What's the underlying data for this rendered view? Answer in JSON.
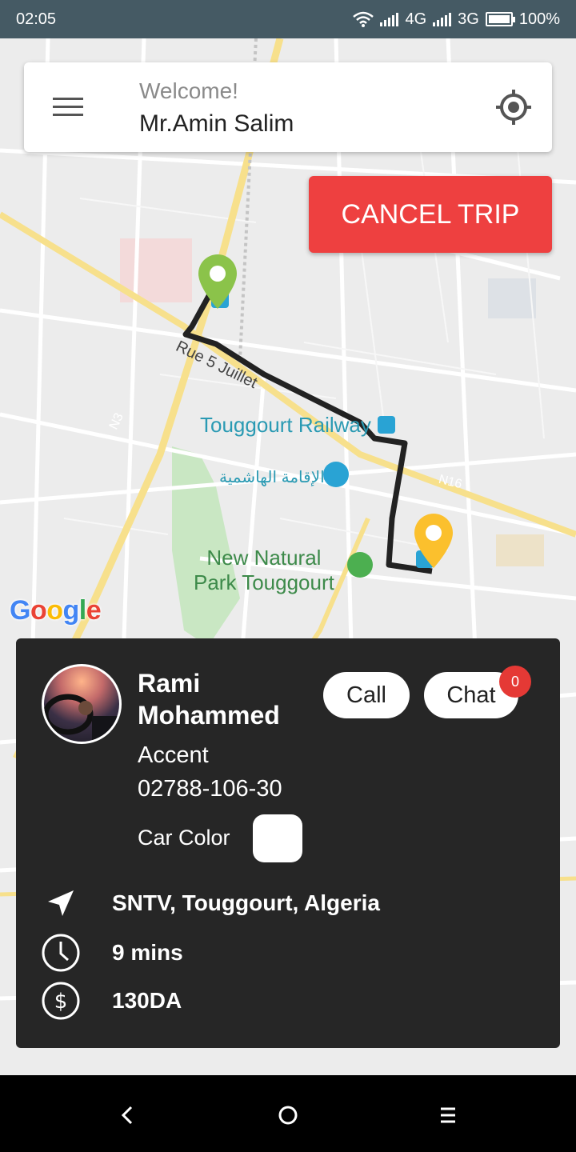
{
  "status_bar": {
    "time": "02:05",
    "network_1": "4G",
    "network_2": "3G",
    "battery": "100%",
    "icons": [
      "wifi-icon",
      "signal-icon",
      "battery-icon"
    ]
  },
  "header": {
    "greeting": "Welcome!",
    "user_name": "Mr.Amin Salim",
    "menu_icon": "hamburger-menu-icon",
    "locate_icon": "my-location-icon"
  },
  "cancel_button": {
    "label": "CANCEL TRIP"
  },
  "map": {
    "labels": {
      "street": "Rue 5 Juillet",
      "railway": "Touggourt Railway",
      "residence": "الإقامة الهاشمية",
      "park_line1": "New Natural",
      "park_line2": "Park Touggourt",
      "road_n3": "N3",
      "road_n16": "N16"
    },
    "google": [
      "G",
      "o",
      "o",
      "g",
      "l",
      "e"
    ]
  },
  "driver": {
    "name": "Rami Mohammed",
    "car_model": "Accent",
    "plate": "02788-106-30",
    "car_color_label": "Car Color",
    "car_color": "#ffffff",
    "call_label": "Call",
    "chat_label": "Chat",
    "chat_unread": "0"
  },
  "trip": {
    "destination": "SNTV, Touggourt, Algeria",
    "eta": "9 mins",
    "fare": "130DA"
  },
  "colors": {
    "accent_red": "#ee4040",
    "card_bg": "#262626",
    "status_bar": "#455a64",
    "pickup_pin": "#8bc34a",
    "dropoff_pin": "#fbc02d"
  }
}
